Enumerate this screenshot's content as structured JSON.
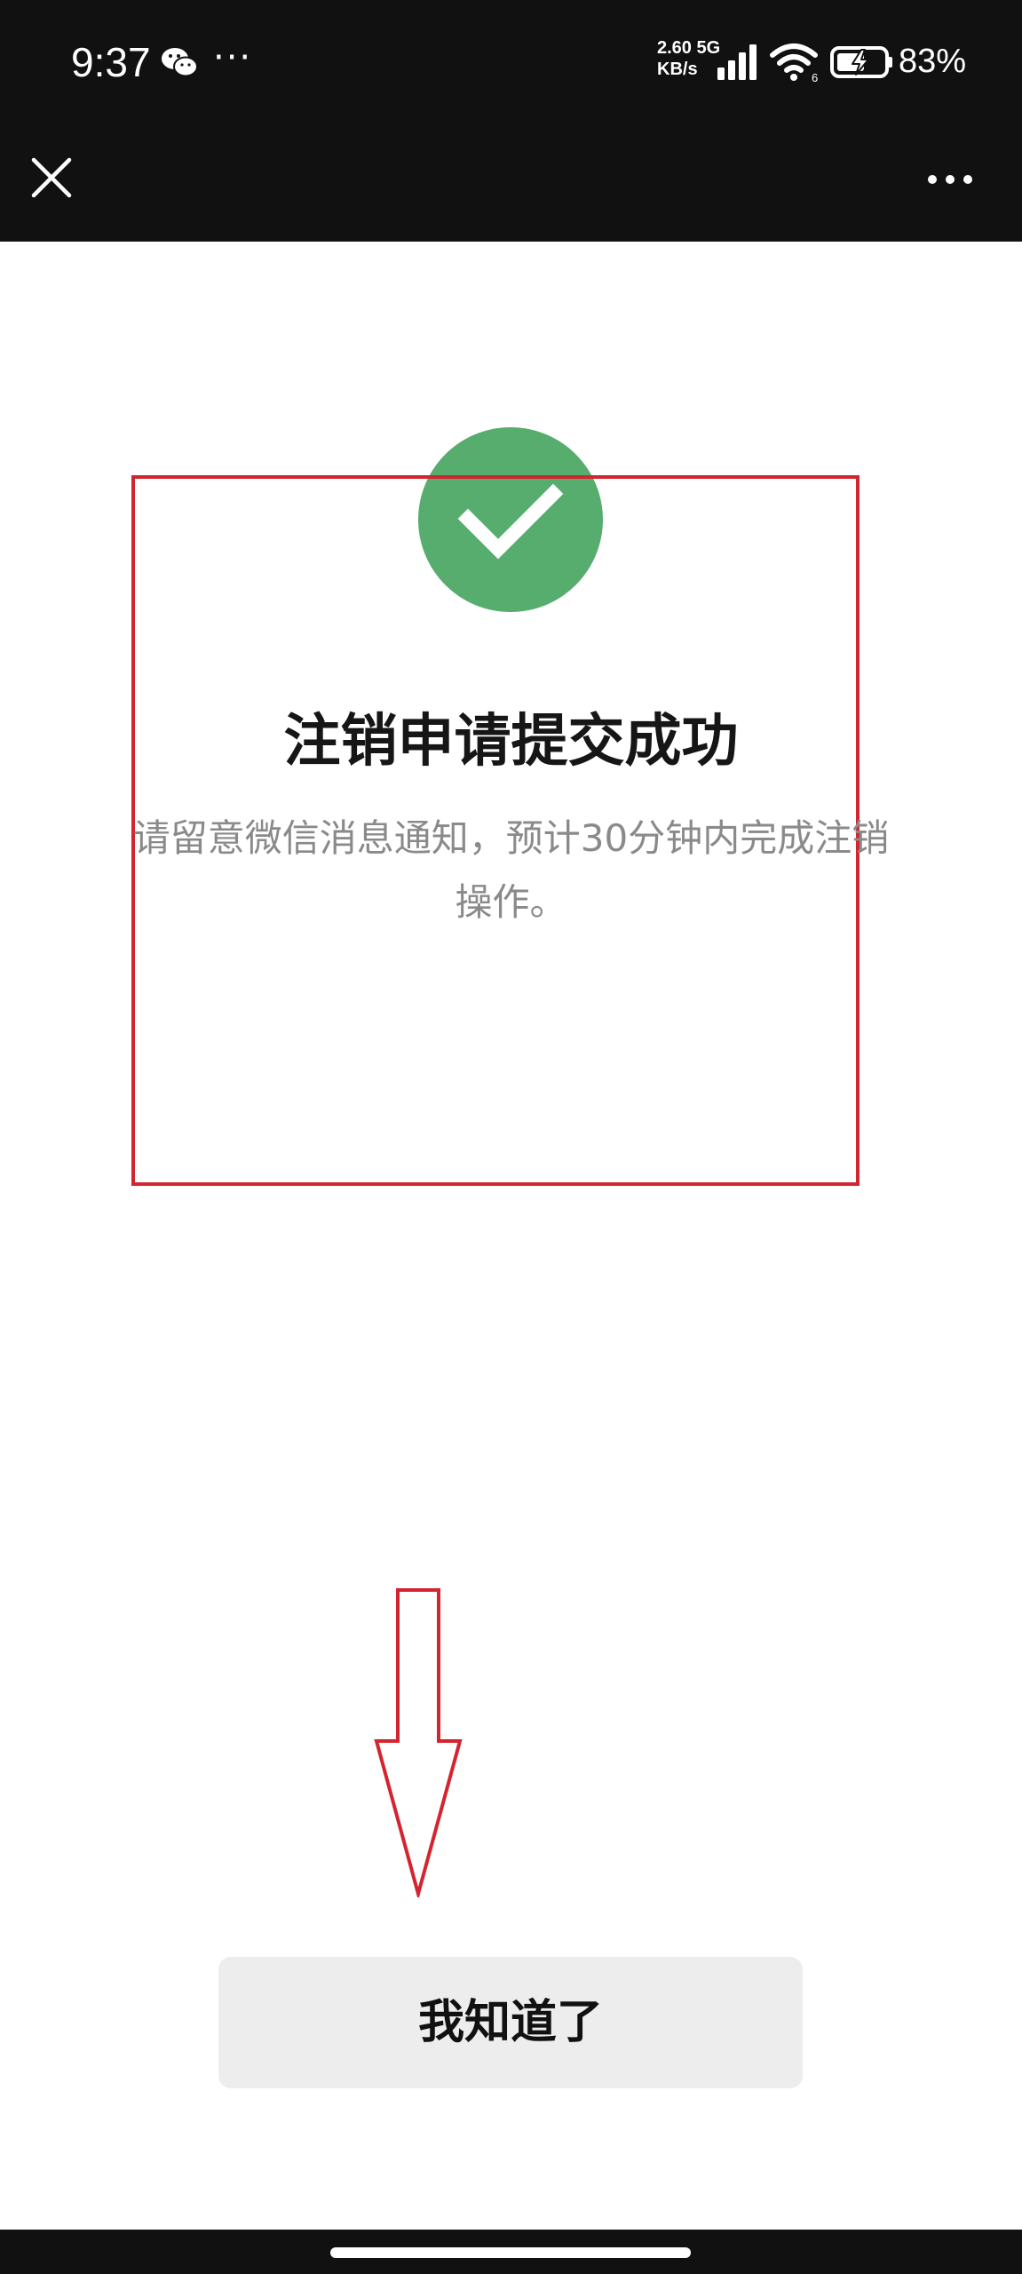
{
  "status_bar": {
    "time": "9:37",
    "more": "···",
    "net_speed_value": "2.60",
    "net_speed_unit": "KB/s",
    "network_type": "5G",
    "wifi_badge": "6",
    "battery": "83%",
    "icons": [
      "wechat-icon",
      "signal-icon",
      "wifi-icon",
      "battery-charging-icon"
    ]
  },
  "nav": {
    "icons": [
      "close-icon",
      "more-icon"
    ]
  },
  "result": {
    "icon": "check-circle-icon",
    "title": "注销申请提交成功",
    "description": "请留意微信消息通知，预计30分钟内完成注销操作。"
  },
  "actions": {
    "ok_label": "我知道了"
  },
  "annotations": {
    "box_color": "#d4242f",
    "arrow_color": "#d4242f"
  },
  "colors": {
    "success_green": "#57ad6e",
    "topbar_bg": "#111111",
    "button_bg": "#ededed"
  }
}
